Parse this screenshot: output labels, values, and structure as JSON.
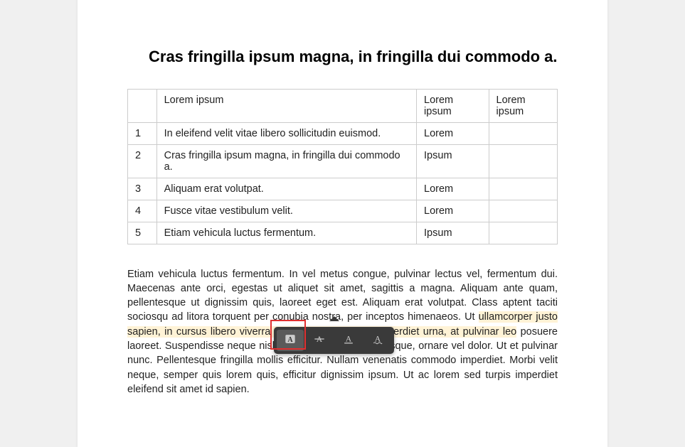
{
  "title": "Cras fringilla ipsum magna, in fringilla dui commodo a.",
  "table": {
    "headers": [
      "",
      "Lorem ipsum",
      "Lorem ipsum",
      "Lorem ipsum"
    ],
    "rows": [
      {
        "num": "1",
        "c2": "In eleifend velit vitae libero sollicitudin euismod.",
        "c3": "Lorem",
        "c4": ""
      },
      {
        "num": "2",
        "c2": "Cras fringilla ipsum magna, in fringilla dui commodo a.",
        "c3": "Ipsum",
        "c4": ""
      },
      {
        "num": "3",
        "c2": "Aliquam erat volutpat.",
        "c3": "Lorem",
        "c4": ""
      },
      {
        "num": "4",
        "c2": "Fusce vitae vestibulum velit.",
        "c3": "Lorem",
        "c4": ""
      },
      {
        "num": "5",
        "c2": "Etiam vehicula luctus fermentum.",
        "c3": "Ipsum",
        "c4": ""
      }
    ]
  },
  "paragraph": {
    "part1": "Etiam vehicula luctus fermentum. In vel metus congue, pulvinar lectus vel, fermentum dui. Maecenas ante orci, egestas ut aliquet sit amet, sagittis a magna. Aliquam ante quam, pellentesque ut dignissim quis, laoreet eget est. Aliquam erat volutpat. Class aptent taciti sociosqu ad litora torquent per conubia nostra, per inceptos himenaeos. Ut ",
    "highlight": "ullamcorper justo sapien, in cursus libero viverra eget. Vivamus auctor imperdiet urna, at pulvinar leo",
    "part2": " posuere laoreet. Suspendisse neque nisl, fringilla at iaculis scelerisque, ornare vel dolor. Ut et pulvinar nunc. Pellentesque fringilla mollis efficitur. Nullam venenatis commodo imperdiet. Morbi velit neque, semper quis lorem quis, efficitur dignissim ipsum. Ut ac lorem sed turpis imperdiet eleifend sit amet id sapien."
  },
  "toolbar": {
    "highlight": "highlight",
    "strikethrough": "strikethrough",
    "underline": "underline",
    "squiggly": "squiggly"
  }
}
